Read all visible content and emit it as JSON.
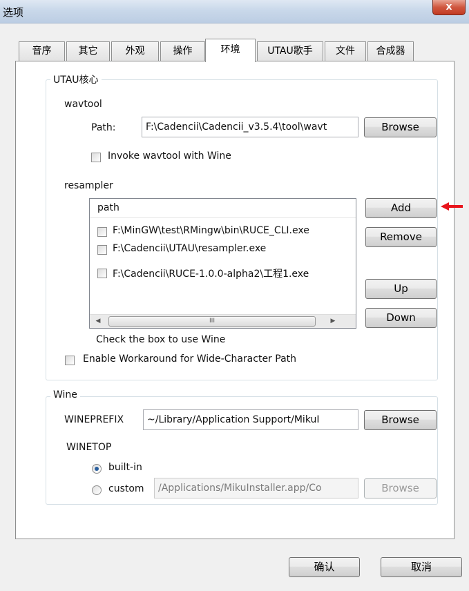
{
  "window": {
    "title": "选项",
    "close_label": "x"
  },
  "tabs": [
    {
      "label": "音序"
    },
    {
      "label": "其它"
    },
    {
      "label": "外观"
    },
    {
      "label": "操作"
    },
    {
      "label": "环境",
      "active": true
    },
    {
      "label": "UTAU歌手"
    },
    {
      "label": "文件"
    },
    {
      "label": "合成器"
    }
  ],
  "utau_core": {
    "group_label": "UTAU核心",
    "wavtool": {
      "label": "wavtool",
      "path_label": "Path:",
      "path_value": "F:\\Cadencii\\Cadencii_v3.5.4\\tool\\wavt",
      "browse_label": "Browse",
      "wine_checkbox_label": "Invoke wavtool with Wine",
      "wine_checked": false
    },
    "resampler": {
      "label": "resampler",
      "column_header": "path",
      "rows": [
        {
          "path": "F:\\MinGW\\test\\RMingw\\bin\\RUCE_CLI.exe",
          "checked": false
        },
        {
          "path": "F:\\Cadencii\\UTAU\\resampler.exe",
          "checked": false
        },
        {
          "path": "F:\\Cadencii\\RUCE-1.0.0-alpha2\\工程1.exe",
          "checked": false
        }
      ],
      "add_label": "Add",
      "remove_label": "Remove",
      "up_label": "Up",
      "down_label": "Down",
      "hint": "Check the box to use Wine",
      "scroll_thumb_grip": "III"
    },
    "workaround_label": "Enable Workaround for Wide-Character Path",
    "workaround_checked": false
  },
  "wine": {
    "group_label": "Wine",
    "wineprefix_label": "WINEPREFIX",
    "wineprefix_value": "~/Library/Application Support/MikuI",
    "wineprefix_browse_label": "Browse",
    "winetop_label": "WINETOP",
    "builtin_label": "built-in",
    "custom_label": "custom",
    "selected": "built-in",
    "custom_value": "/Applications/MikuInstaller.app/Co",
    "custom_browse_label": "Browse"
  },
  "footer": {
    "ok_label": "确认",
    "cancel_label": "取消"
  },
  "colors": {
    "annotation_arrow": "#e8141c",
    "radio_dot": "#2a5f9e"
  },
  "icons": {
    "annotation": "red-arrow-icon"
  }
}
